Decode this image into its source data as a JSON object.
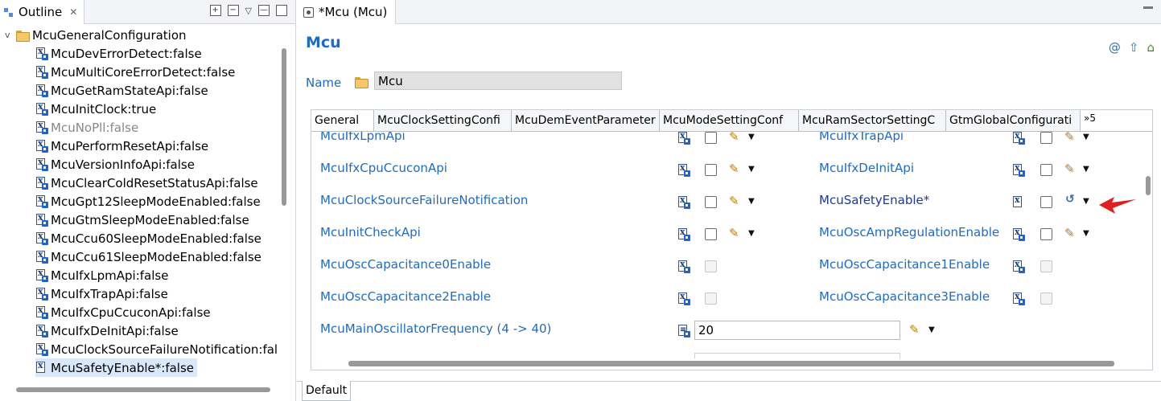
{
  "outline": {
    "tab_title": "Outline",
    "close_glyph": "✕",
    "tree": {
      "root": "McuGeneralConfiguration",
      "items": [
        {
          "label": "McuDevErrorDetect:false",
          "state": "normal"
        },
        {
          "label": "McuMultiCoreErrorDetect:false",
          "state": "normal"
        },
        {
          "label": "McuGetRamStateApi:false",
          "state": "normal"
        },
        {
          "label": "McuInitClock:true",
          "state": "normal"
        },
        {
          "label": "McuNoPll:false",
          "state": "disabled"
        },
        {
          "label": "McuPerformResetApi:false",
          "state": "normal"
        },
        {
          "label": "McuVersionInfoApi:false",
          "state": "normal"
        },
        {
          "label": "McuClearColdResetStatusApi:false",
          "state": "normal"
        },
        {
          "label": "McuGpt12SleepModeEnabled:false",
          "state": "normal"
        },
        {
          "label": "McuGtmSleepModeEnabled:false",
          "state": "normal"
        },
        {
          "label": "McuCcu60SleepModeEnabled:false",
          "state": "normal"
        },
        {
          "label": "McuCcu61SleepModeEnabled:false",
          "state": "normal"
        },
        {
          "label": "McuIfxLpmApi:false",
          "state": "normal"
        },
        {
          "label": "McuIfxTrapApi:false",
          "state": "normal"
        },
        {
          "label": "McuIfxCpuCcuconApi:false",
          "state": "normal"
        },
        {
          "label": "McuIfxDeInitApi:false",
          "state": "normal"
        },
        {
          "label": "McuClockSourceFailureNotification:fal",
          "state": "normal"
        },
        {
          "label": "McuSafetyEnable*:false",
          "state": "selected"
        }
      ]
    }
  },
  "editor": {
    "tab_title": "*Mcu (Mcu)",
    "header_title": "Mcu",
    "name_label": "Name",
    "name_value": "Mcu",
    "tabs": [
      "General",
      "McuClockSettingConfi",
      "McuDemEventParameter",
      "McuModeSettingConf",
      "McuRamSectorSettingC",
      "GtmGlobalConfigurati"
    ],
    "tabs_overflow": "»5",
    "rows": [
      {
        "left": "McuIfxLpmApi",
        "right": "McuIfxTrapApi"
      },
      {
        "left": "McuIfxCpuCcuconApi",
        "right": "McuIfxDeInitApi"
      },
      {
        "left": "McuClockSourceFailureNotification",
        "right": "McuSafetyEnable*"
      },
      {
        "left": "McuInitCheckApi",
        "right": "McuOscAmpRegulationEnable"
      },
      {
        "left": "McuOscCapacitance0Enable",
        "right": "McuOscCapacitance1Enable"
      },
      {
        "left": "McuOscCapacitance2Enable",
        "right": "McuOscCapacitance3Enable"
      }
    ],
    "freq_label": "McuMainOscillatorFrequency (4 -> 40)",
    "freq_value": "20",
    "bottom_tab": "Default"
  }
}
